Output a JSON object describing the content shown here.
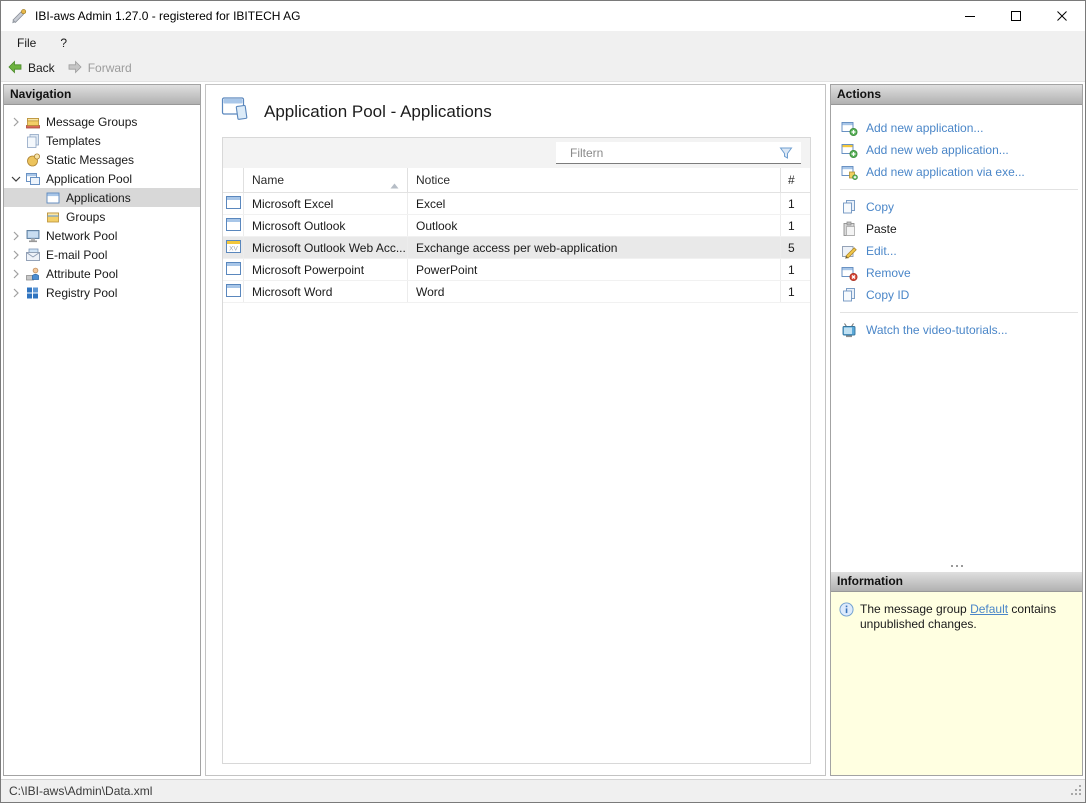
{
  "window": {
    "title": "IBI-aws Admin 1.27.0 - registered for IBITECH AG"
  },
  "menu": {
    "file": "File",
    "help": "?"
  },
  "toolbar": {
    "back": "Back",
    "forward": "Forward"
  },
  "navigation": {
    "header": "Navigation",
    "items": [
      {
        "label": "Message Groups",
        "icon": "message-groups-icon",
        "state": "collapsed",
        "level": 0
      },
      {
        "label": "Templates",
        "icon": "templates-icon",
        "state": "leaf",
        "level": 0
      },
      {
        "label": "Static Messages",
        "icon": "static-messages-icon",
        "state": "leaf",
        "level": 0
      },
      {
        "label": "Application Pool",
        "icon": "application-pool-icon",
        "state": "expanded",
        "level": 0
      },
      {
        "label": "Applications",
        "icon": "applications-icon",
        "state": "leaf",
        "level": 1,
        "selected": true
      },
      {
        "label": "Groups",
        "icon": "groups-icon",
        "state": "leaf",
        "level": 1
      },
      {
        "label": "Network Pool",
        "icon": "network-pool-icon",
        "state": "collapsed",
        "level": 0
      },
      {
        "label": "E-mail Pool",
        "icon": "email-pool-icon",
        "state": "collapsed",
        "level": 0
      },
      {
        "label": "Attribute Pool",
        "icon": "attribute-pool-icon",
        "state": "collapsed",
        "level": 0
      },
      {
        "label": "Registry Pool",
        "icon": "registry-pool-icon",
        "state": "collapsed",
        "level": 0
      }
    ]
  },
  "main": {
    "title": "Application Pool - Applications",
    "filter": {
      "placeholder": "Filtern"
    },
    "table": {
      "columns": [
        "Name",
        "Notice",
        "#"
      ],
      "sort_column": "Name",
      "sort_direction": "ascending",
      "rows": [
        {
          "icon": "app-window-icon",
          "name": "Microsoft Excel",
          "notice": "Excel",
          "count": "1",
          "selected": false
        },
        {
          "icon": "app-window-icon",
          "name": "Microsoft Outlook",
          "notice": "Outlook",
          "count": "1",
          "selected": false
        },
        {
          "icon": "web-app-icon",
          "name": "Microsoft Outlook Web Acc...",
          "notice": "Exchange access per web-application",
          "count": "5",
          "selected": true
        },
        {
          "icon": "app-window-icon",
          "name": "Microsoft Powerpoint",
          "notice": "PowerPoint",
          "count": "1",
          "selected": false
        },
        {
          "icon": "app-window-icon",
          "name": "Microsoft Word",
          "notice": "Word",
          "count": "1",
          "selected": false
        }
      ]
    }
  },
  "actions": {
    "header": "Actions",
    "items": [
      {
        "label": "Add new application...",
        "icon": "add-application-icon",
        "enabled": true
      },
      {
        "label": "Add new web application...",
        "icon": "add-web-application-icon",
        "enabled": true
      },
      {
        "label": "Add new application via exe...",
        "icon": "add-application-exe-icon",
        "enabled": true
      },
      {
        "label": "Copy",
        "icon": "copy-icon",
        "enabled": true
      },
      {
        "label": "Paste",
        "icon": "paste-icon",
        "enabled": false
      },
      {
        "label": "Edit...",
        "icon": "edit-icon",
        "enabled": true
      },
      {
        "label": "Remove",
        "icon": "remove-icon",
        "enabled": true
      },
      {
        "label": "Copy ID",
        "icon": "copy-id-icon",
        "enabled": true
      },
      {
        "label": "Watch the video-tutorials...",
        "icon": "video-tutorials-icon",
        "enabled": true
      }
    ]
  },
  "information": {
    "header": "Information",
    "text_before": "The message group ",
    "link": "Default",
    "text_after": " contains unpublished changes."
  },
  "statusbar": {
    "path": "C:\\IBI-aws\\Admin\\Data.xml"
  },
  "icons": {
    "back": "green-left-arrow",
    "forward": "gray-right-arrow",
    "filter": "funnel",
    "sort": "triangle-up",
    "information": "blue-info-circle",
    "resize": "grip-dots"
  },
  "colors": {
    "link": "#4a86c8",
    "selection_row": "#e9e9e9",
    "selection_tree": "#d8d8d8",
    "info_background": "#ffffe1",
    "panel_header_top": "#dfdfdf",
    "panel_header_bottom": "#b1b1b1",
    "chrome": "#f0f0f0"
  }
}
